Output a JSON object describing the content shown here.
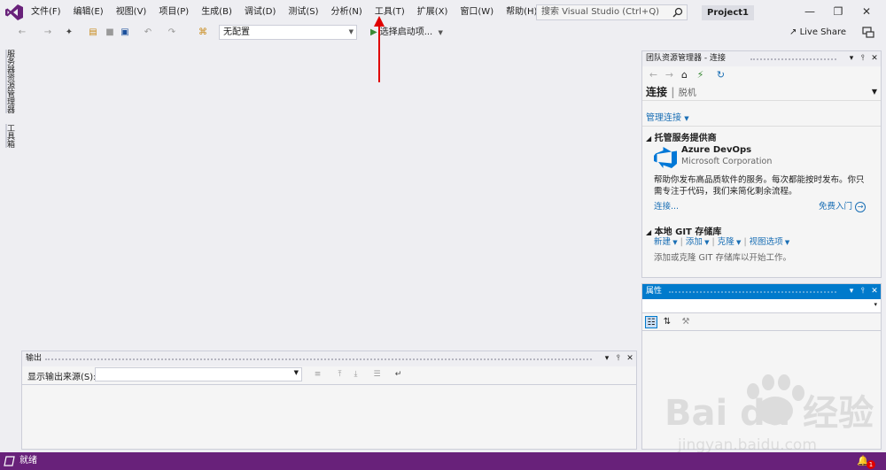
{
  "menubar": {
    "items": [
      "文件(F)",
      "编辑(E)",
      "视图(V)",
      "项目(P)",
      "生成(B)",
      "调试(D)",
      "测试(S)",
      "分析(N)",
      "工具(T)",
      "扩展(X)",
      "窗口(W)",
      "帮助(H)"
    ],
    "search_placeholder": "搜索 Visual Studio (Ctrl+Q)",
    "project_name": "Project1"
  },
  "toolbar": {
    "configuration": "无配置",
    "start_label": "选择启动项...",
    "live_share": "Live Share"
  },
  "side_tabs": [
    "服务器资源管理器",
    "工具箱"
  ],
  "team_explorer": {
    "title": "团队资源管理器 - 连接",
    "heading": "连接",
    "heading_sub": "脱机",
    "manage_connections": "管理连接",
    "hosting_section": "托管服务提供商",
    "azure_name": "Azure DevOps",
    "azure_company": "Microsoft Corporation",
    "azure_desc_1": "帮助你发布高品质软件的服务。每次都能按时发布。你只",
    "azure_desc_2": "需专注于代码，我们来简化剩余流程。",
    "connect_link": "连接...",
    "get_started_link": "免费入门",
    "git_section": "本地 GIT 存储库",
    "git_actions": [
      "新建",
      "添加",
      "克隆",
      "视图选项"
    ],
    "git_hint": "添加或克隆 GIT 存储库以开始工作。"
  },
  "properties": {
    "title": "属性"
  },
  "output": {
    "title": "输出",
    "source_label": "显示输出来源(S):"
  },
  "statusbar": {
    "text": "就绪",
    "notification_count": "1"
  },
  "watermark": {
    "brand": "Bai du 经验",
    "url": "jingyan.baidu.com"
  },
  "colors": {
    "status_bar": "#68217a",
    "accent": "#007acc",
    "vs_logo": "#68217a",
    "annotation_arrow": "#e00000"
  }
}
